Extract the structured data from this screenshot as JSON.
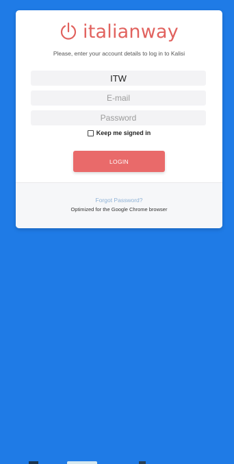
{
  "logo": {
    "text": "italianway",
    "icon": "power-icon",
    "color": "#e1625e"
  },
  "subtitle": "Please, enter your account details to log in to Kalisi",
  "form": {
    "company_value": "ITW",
    "email_placeholder": "E-mail",
    "password_placeholder": "Password",
    "keep_signed_in_label": "Keep me signed in",
    "login_label": "LOGIN"
  },
  "footer": {
    "forgot_password": "Forgot Password?",
    "browser_note": "Optimized for the Google Chrome browser"
  },
  "colors": {
    "background": "#1f7be6",
    "accent": "#e96a6a",
    "link": "#8fb2d6"
  }
}
